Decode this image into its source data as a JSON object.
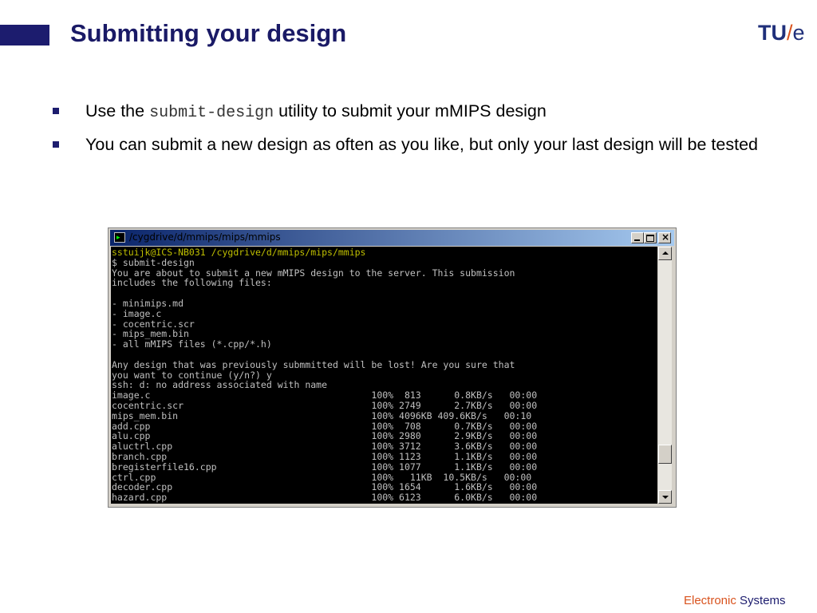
{
  "slide": {
    "title": "Submitting your design",
    "logo": {
      "part1": "TU",
      "slash": "/",
      "part2": "e"
    },
    "bullets": [
      {
        "before": "Use the ",
        "code": "submit-design",
        "after": " utility to submit your mMIPS design"
      },
      {
        "text": "You can submit a new design as often as you like, but only your last design will be tested"
      }
    ],
    "footer": {
      "part1": "Electronic",
      "part2": " Systems"
    }
  },
  "window": {
    "title": "/cygdrive/d/mmips/mips/mmips",
    "console": {
      "prompt": "sstuijk@ICS-NB031 /cygdrive/d/mmips/mips/mmips",
      "lines": [
        "$ submit-design",
        "You are about to submit a new mMIPS design to the server. This submission",
        "includes the following files:",
        "",
        "- minimips.md",
        "- image.c",
        "- cocentric.scr",
        "- mips_mem.bin",
        "- all mMIPS files (*.cpp/*.h)",
        "",
        "Any design that was previously submmitted will be lost! Are you sure that",
        "you want to continue (y/n?) y",
        "ssh: d: no address associated with name",
        "image.c                                        100%  813      0.8KB/s   00:00",
        "cocentric.scr                                  100% 2749      2.7KB/s   00:00",
        "mips_mem.bin                                   100% 4096KB 409.6KB/s   00:10",
        "add.cpp                                        100%  708      0.7KB/s   00:00",
        "alu.cpp                                        100% 2980      2.9KB/s   00:00",
        "aluctrl.cpp                                    100% 3712      3.6KB/s   00:00",
        "branch.cpp                                     100% 1123      1.1KB/s   00:00",
        "bregisterfile16.cpp                            100% 1077      1.1KB/s   00:00",
        "ctrl.cpp                                       100%   11KB  10.5KB/s   00:00",
        "decoder.cpp                                    100% 1654      1.6KB/s   00:00",
        "hazard.cpp                                     100% 6123      6.0KB/s   00:00"
      ]
    }
  }
}
